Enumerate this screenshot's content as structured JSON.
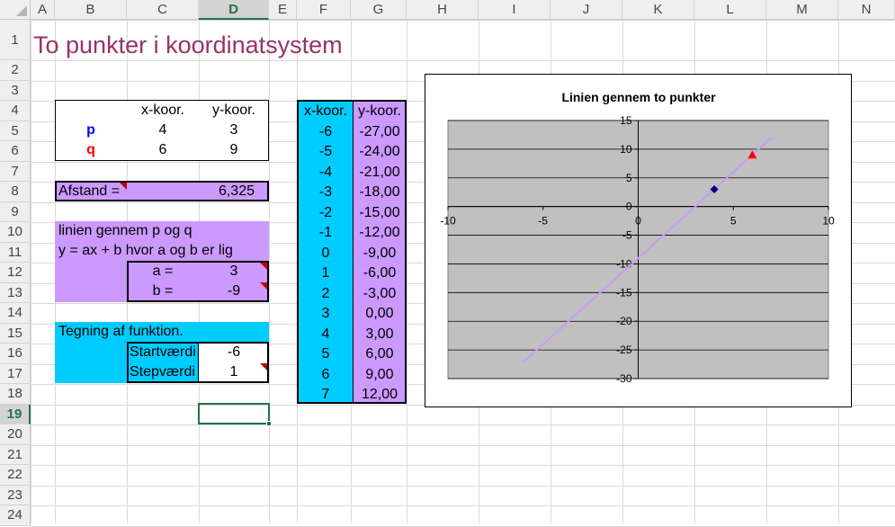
{
  "columns": [
    "A",
    "B",
    "C",
    "D",
    "E",
    "F",
    "G",
    "H",
    "I",
    "J",
    "K",
    "L",
    "M",
    "N"
  ],
  "rows": [
    "1",
    "2",
    "3",
    "4",
    "5",
    "6",
    "7",
    "8",
    "9",
    "10",
    "11",
    "12",
    "13",
    "14",
    "15",
    "16",
    "17",
    "18",
    "19",
    "20",
    "21",
    "22",
    "23",
    "24"
  ],
  "title": "To punkter i koordinatsystem",
  "point_table": {
    "hdr_x": "x-koor.",
    "hdr_y": "y-koor.",
    "p_label": "p",
    "p_x": "4",
    "p_y": "3",
    "q_label": "q",
    "q_x": "6",
    "q_y": "9"
  },
  "distance": {
    "label": "Afstand =",
    "value": "6,325"
  },
  "line_block": {
    "line1": "linien gennem p og q",
    "line2": "y = ax + b hvor a og b er lig",
    "a_label": "a =",
    "a_value": "3",
    "b_label": "b =",
    "b_value": "-9"
  },
  "drawing": {
    "heading": "Tegning af funktion.",
    "start_label": "Startværdi",
    "start_value": "-6",
    "step_label": "Stepværdi",
    "step_value": "1"
  },
  "values_table": {
    "hdr_x": "x-koor.",
    "hdr_y": "y-koor.",
    "x": [
      "-6",
      "-5",
      "-4",
      "-3",
      "-2",
      "-1",
      "0",
      "1",
      "2",
      "3",
      "4",
      "5",
      "6",
      "7"
    ],
    "y": [
      "-27,00",
      "-24,00",
      "-21,00",
      "-18,00",
      "-15,00",
      "-12,00",
      "-9,00",
      "-6,00",
      "-3,00",
      "0,00",
      "3,00",
      "6,00",
      "9,00",
      "12,00"
    ]
  },
  "colors": {
    "purple": "#cc99ff",
    "cyan": "#00ccff",
    "title": "#993366",
    "plot_bg": "#c0c0c0",
    "p_color": "#000080",
    "q_color": "#ff0000",
    "line": "#cc99ff"
  },
  "chart_data": {
    "type": "scatter",
    "title": "Linien gennem to punkter",
    "xlim": [
      -10,
      10
    ],
    "ylim": [
      -30,
      15
    ],
    "x_ticks": [
      -10,
      -5,
      0,
      5,
      10
    ],
    "y_ticks": [
      15,
      10,
      5,
      0,
      -5,
      -10,
      -15,
      -20,
      -25,
      -30
    ],
    "x_tick_labels": [
      "-10",
      "-5",
      "0",
      "5",
      "10"
    ],
    "y_tick_labels": [
      "15",
      "10",
      "5",
      "0",
      "-5",
      "-10",
      "-15",
      "-20",
      "-25",
      "-30"
    ],
    "grid": true,
    "series": [
      {
        "kind": "line",
        "color": "#cc99ff",
        "x": [
          -6,
          7
        ],
        "y": [
          -27,
          12
        ]
      },
      {
        "kind": "point",
        "marker": "diamond",
        "color": "#000080",
        "x": [
          4
        ],
        "y": [
          3
        ]
      },
      {
        "kind": "point",
        "marker": "triangle",
        "color": "#ff0000",
        "x": [
          6
        ],
        "y": [
          9
        ]
      }
    ]
  }
}
